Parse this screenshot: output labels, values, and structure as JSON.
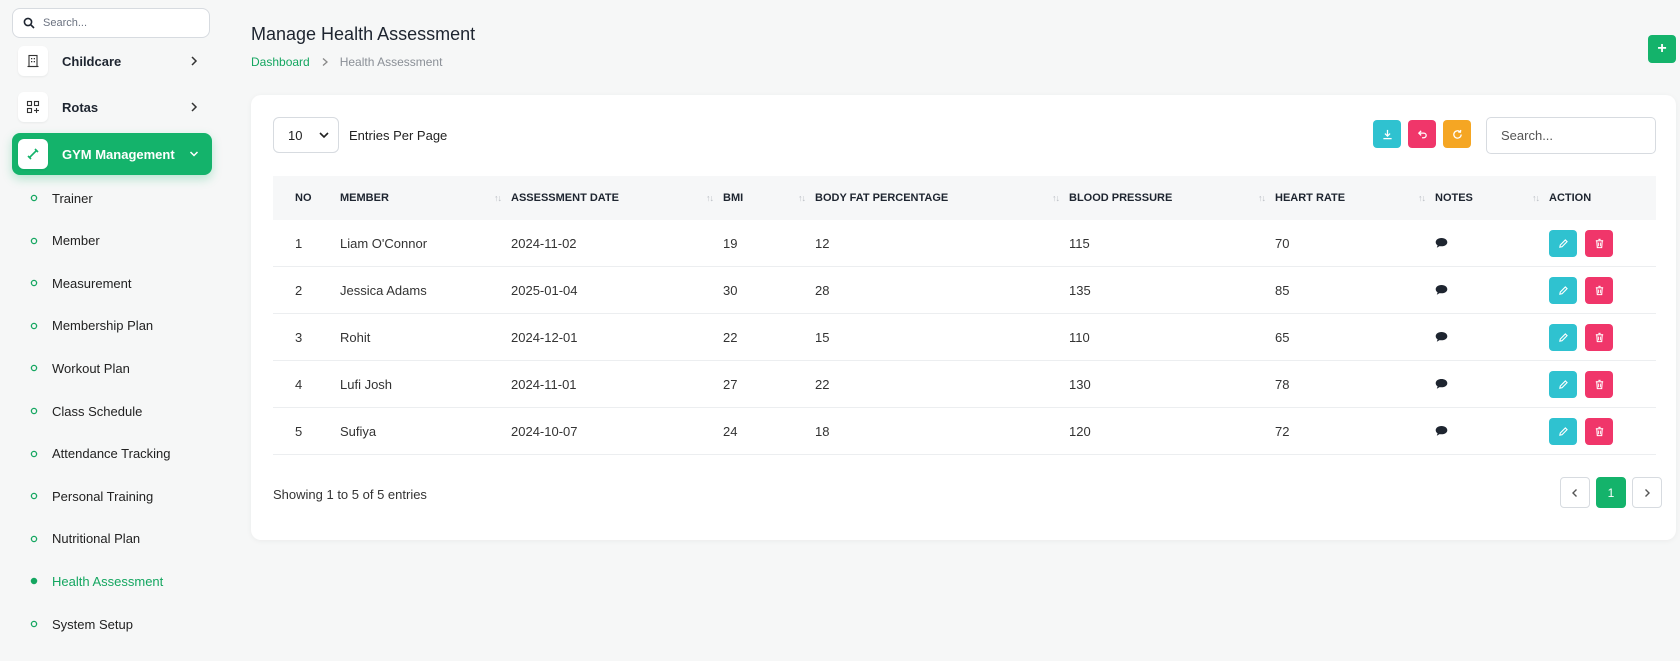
{
  "sidebar": {
    "search_placeholder": "Search...",
    "groups": [
      {
        "label": "Childcare",
        "icon": "building-icon"
      },
      {
        "label": "Rotas",
        "icon": "apps-add-icon"
      },
      {
        "label": "GYM Management",
        "icon": "dumbbell-icon",
        "active": true
      }
    ],
    "items": [
      {
        "label": "Trainer"
      },
      {
        "label": "Member"
      },
      {
        "label": "Measurement"
      },
      {
        "label": "Membership Plan"
      },
      {
        "label": "Workout Plan"
      },
      {
        "label": "Class Schedule"
      },
      {
        "label": "Attendance Tracking"
      },
      {
        "label": "Personal Training"
      },
      {
        "label": "Nutritional Plan"
      },
      {
        "label": "Health Assessment",
        "current": true
      },
      {
        "label": "System Setup"
      }
    ]
  },
  "header": {
    "title": "Manage Health Assessment",
    "breadcrumb": {
      "home": "Dashboard",
      "current": "Health Assessment"
    },
    "add_label": "+"
  },
  "toolbar": {
    "entries_value": "10",
    "entries_label": "Entries Per Page",
    "search_placeholder": "Search..."
  },
  "table": {
    "columns": [
      "NO",
      "MEMBER",
      "ASSESSMENT DATE",
      "BMI",
      "BODY FAT PERCENTAGE",
      "BLOOD PRESSURE",
      "HEART RATE",
      "NOTES",
      "ACTION"
    ],
    "rows": [
      {
        "no": "1",
        "member": "Liam O'Connor",
        "date": "2024-11-02",
        "bmi": "19",
        "fat": "12",
        "bp": "115",
        "hr": "70"
      },
      {
        "no": "2",
        "member": "Jessica Adams",
        "date": "2025-01-04",
        "bmi": "30",
        "fat": "28",
        "bp": "135",
        "hr": "85"
      },
      {
        "no": "3",
        "member": "Rohit",
        "date": "2024-12-01",
        "bmi": "22",
        "fat": "15",
        "bp": "110",
        "hr": "65"
      },
      {
        "no": "4",
        "member": "Lufi Josh",
        "date": "2024-11-01",
        "bmi": "27",
        "fat": "22",
        "bp": "130",
        "hr": "78"
      },
      {
        "no": "5",
        "member": "Sufiya",
        "date": "2024-10-07",
        "bmi": "24",
        "fat": "18",
        "bp": "120",
        "hr": "72"
      }
    ]
  },
  "footer": {
    "showing": "Showing 1 to 5 of 5 entries",
    "current_page": "1"
  },
  "colors": {
    "brand": "#14b36b",
    "download": "#2fc2d0",
    "reset": "#f0366a",
    "refresh": "#f5a623"
  }
}
